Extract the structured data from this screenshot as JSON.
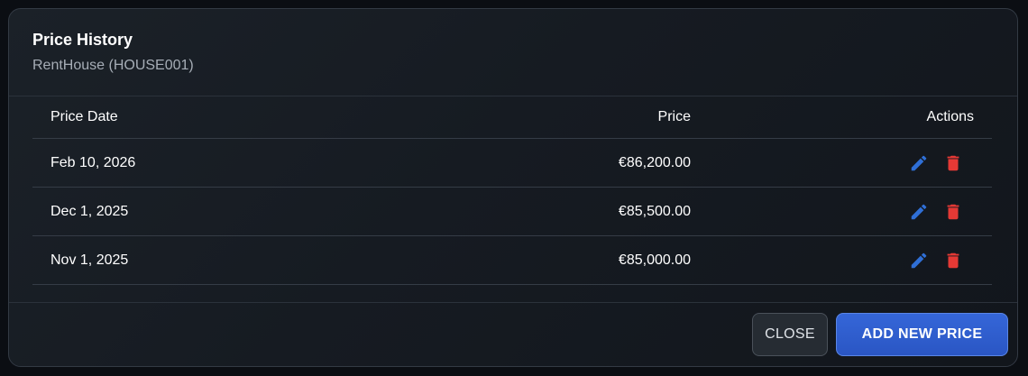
{
  "dialog": {
    "title": "Price History",
    "subtitle": "RentHouse (HOUSE001)"
  },
  "table": {
    "columns": {
      "date": "Price Date",
      "price": "Price",
      "actions": "Actions"
    },
    "rows": [
      {
        "date": "Feb 10, 2026",
        "price": "€86,200.00"
      },
      {
        "date": "Dec 1, 2025",
        "price": "€85,500.00"
      },
      {
        "date": "Nov 1, 2025",
        "price": "€85,000.00"
      }
    ],
    "row_actions": [
      {
        "icon": "pencil-icon",
        "color": "#2f6fd6"
      },
      {
        "icon": "trash-icon",
        "color": "#e53935"
      }
    ]
  },
  "footer": {
    "close_label": "CLOSE",
    "add_label": "ADD NEW PRICE"
  },
  "colors": {
    "accent": "#2f5fd0",
    "edit": "#2f6fd6",
    "delete": "#e53935"
  }
}
